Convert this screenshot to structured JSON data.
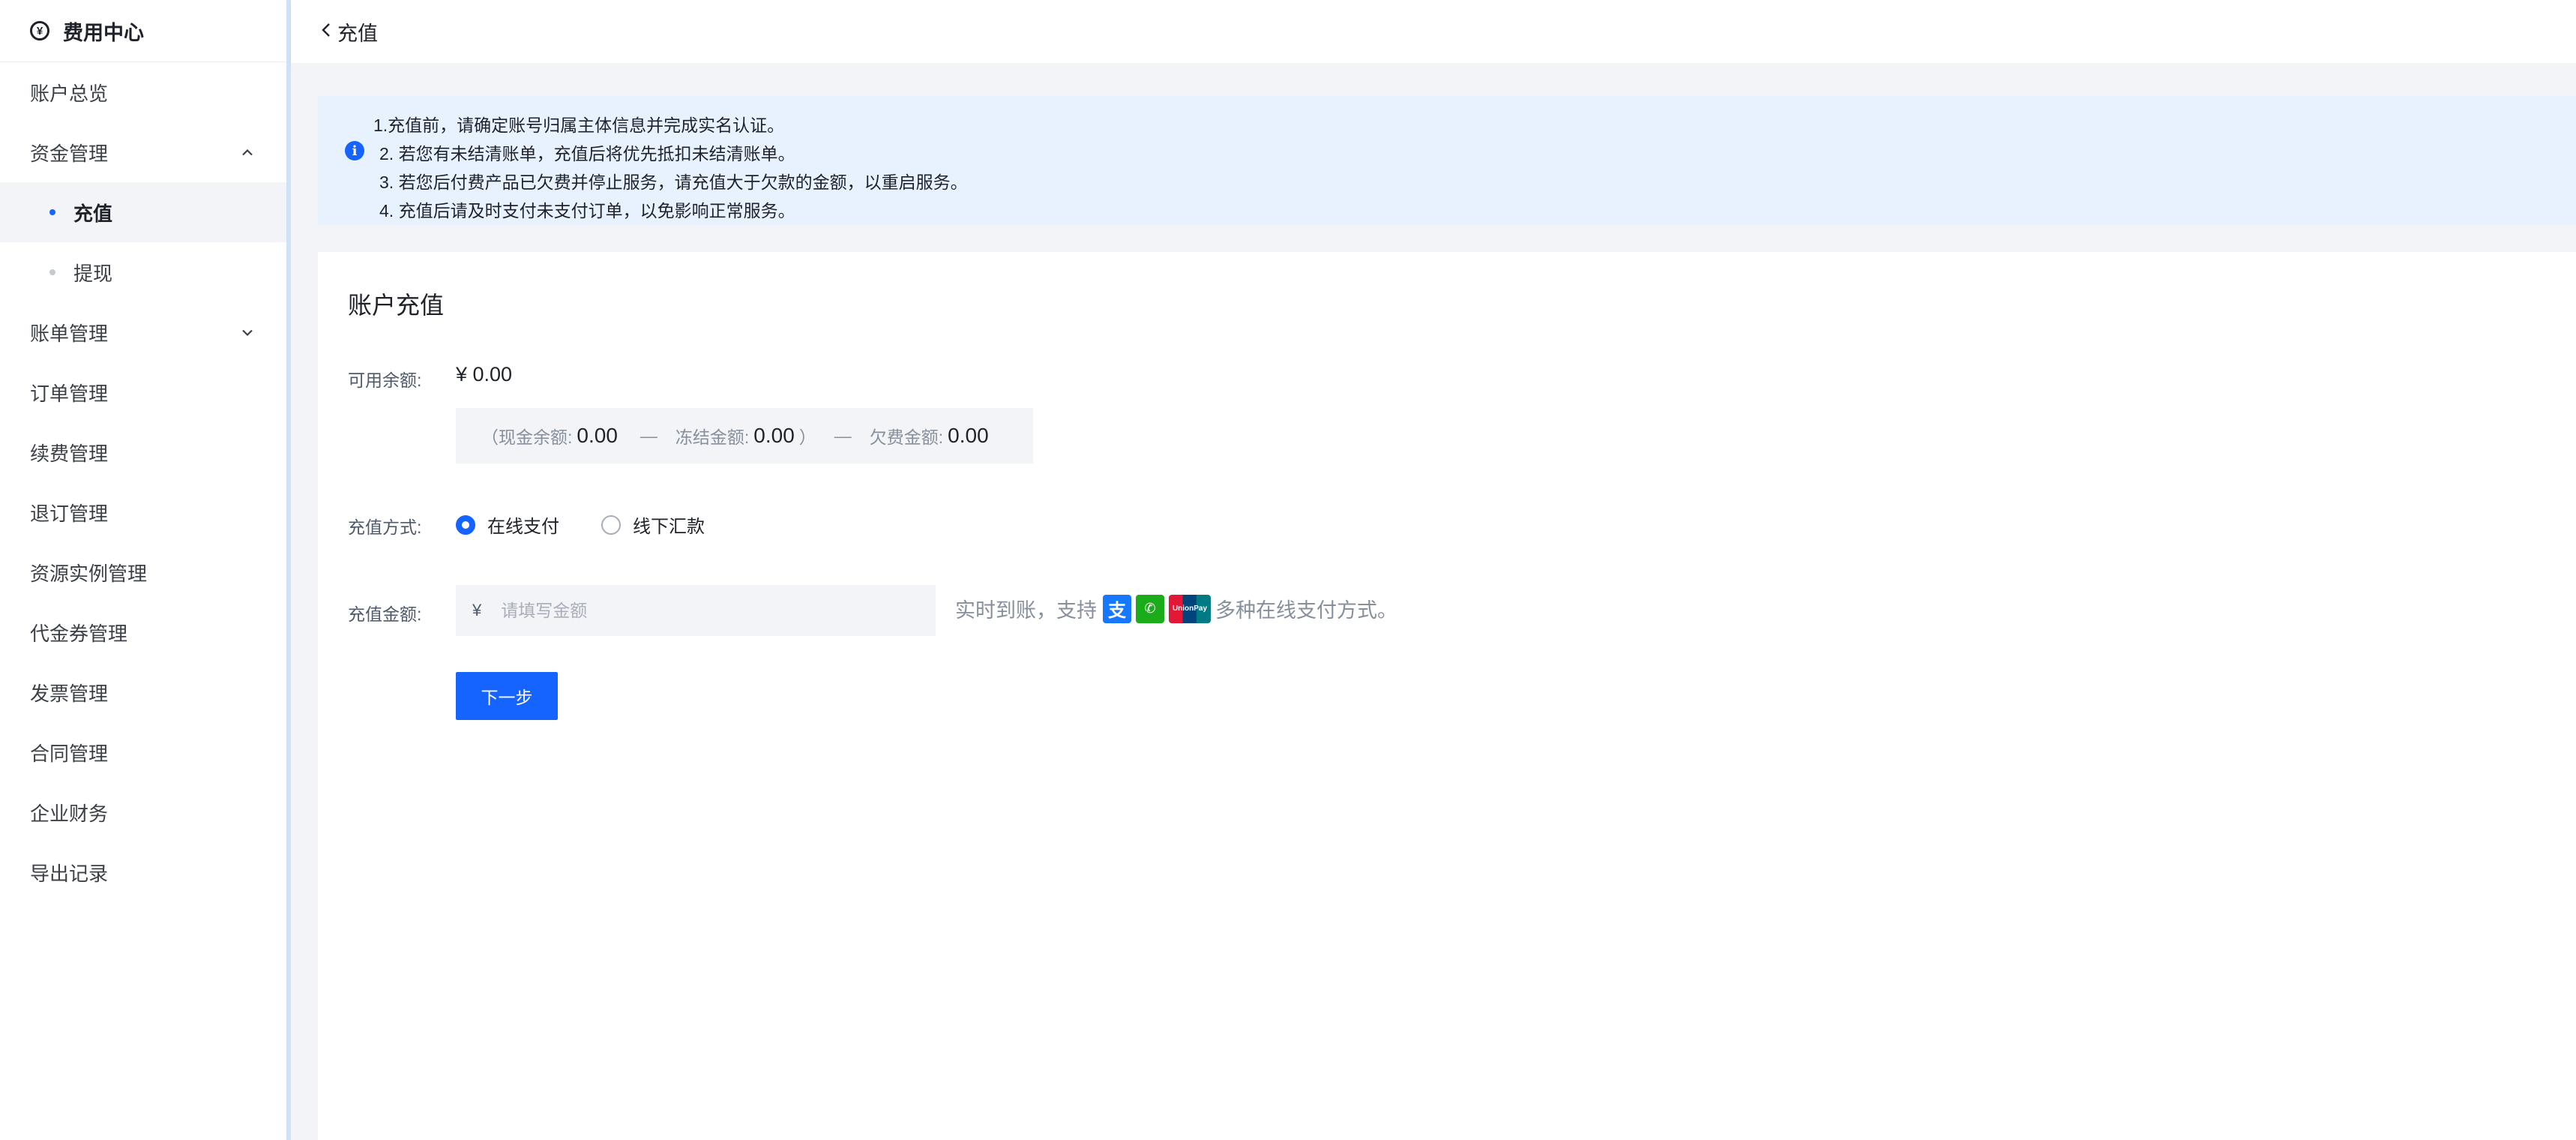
{
  "sidebar": {
    "title": "费用中心",
    "items": [
      {
        "label": "账户总览"
      },
      {
        "label": "资金管理"
      },
      {
        "label": "充值"
      },
      {
        "label": "提现"
      },
      {
        "label": "账单管理"
      },
      {
        "label": "订单管理"
      },
      {
        "label": "续费管理"
      },
      {
        "label": "退订管理"
      },
      {
        "label": "资源实例管理"
      },
      {
        "label": "代金券管理"
      },
      {
        "label": "发票管理"
      },
      {
        "label": "合同管理"
      },
      {
        "label": "企业财务"
      },
      {
        "label": "导出记录"
      }
    ]
  },
  "header": {
    "title": "充值"
  },
  "notice": {
    "lines": [
      "1.充值前，请确定账号归属主体信息并完成实名认证。",
      "2. 若您有未结清账单，充值后将优先抵扣未结清账单。",
      "3. 若您后付费产品已欠费并停止服务，请充值大于欠款的金额，以重启服务。",
      "4. 充值后请及时支付未支付订单，以免影响正常服务。"
    ]
  },
  "card": {
    "title": "账户充值",
    "balance_label": "可用余额:",
    "balance_value": "¥ 0.00",
    "cash_label": "（现金余额:",
    "cash_value": "0.00",
    "frozen_label": "冻结金额:",
    "frozen_value": "0.00",
    "close_paren": "）",
    "debt_label": "欠费金额:",
    "debt_value": "0.00",
    "dash": "—",
    "method_label": "充值方式:",
    "method_online": "在线支付",
    "method_offline": "线下汇款",
    "amount_label": "充值金额:",
    "amount_prefix": "¥",
    "amount_placeholder": "请填写金额",
    "amount_value": "",
    "hint_prefix": "实时到账，支持",
    "hint_suffix": "多种在线支付方式。",
    "next_button": "下一步"
  },
  "icons": {
    "logo": "yen-circle-icon",
    "back": "chevron-left-icon",
    "info": "info-icon",
    "expand": "chevron-up-icon",
    "collapse": "chevron-down-icon",
    "payments": [
      "alipay-icon",
      "wechat-pay-icon",
      "unionpay-icon"
    ]
  },
  "colors": {
    "accent": "#1664ff",
    "notice_bg": "#e8f2ff",
    "page_bg": "#f2f4f8"
  }
}
